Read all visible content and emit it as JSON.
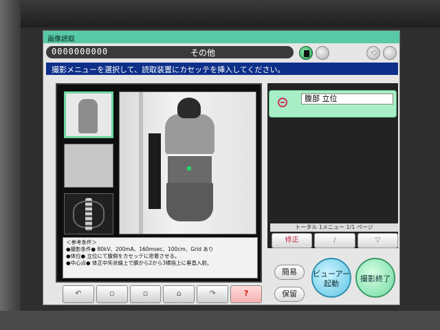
{
  "window": {
    "title": "画像読取"
  },
  "patient": {
    "id": "0000000000",
    "name": "その他"
  },
  "instruction": "撮影メニューを選択して、読取装置にカセッテを挿入してください。",
  "conditions": {
    "header": "＜参考条件＞",
    "line1": "●撮影条件● 80kV、200mA、160msec、100cm、Grid あり",
    "line2": "●体位● 立位にて腹側をカセッテに密着させる。",
    "line3": "●中心点● 体正中矢状線上で臍から2から3横指上に垂直入射。"
  },
  "menu": {
    "item_1": "腹部 立位"
  },
  "page_info": "トータル 1メニュー 1/1 ページ",
  "nav": {
    "edit": "修正"
  },
  "buttons": {
    "simple": "簡易",
    "hold": "保留",
    "viewer_line1": "ビューアー",
    "viewer_line2": "起動",
    "finish": "撮影終了"
  },
  "colors": {
    "title_green": "#58c9a6",
    "instruction_blue": "#0d2f8a",
    "menu_green": "#a8efc7"
  }
}
